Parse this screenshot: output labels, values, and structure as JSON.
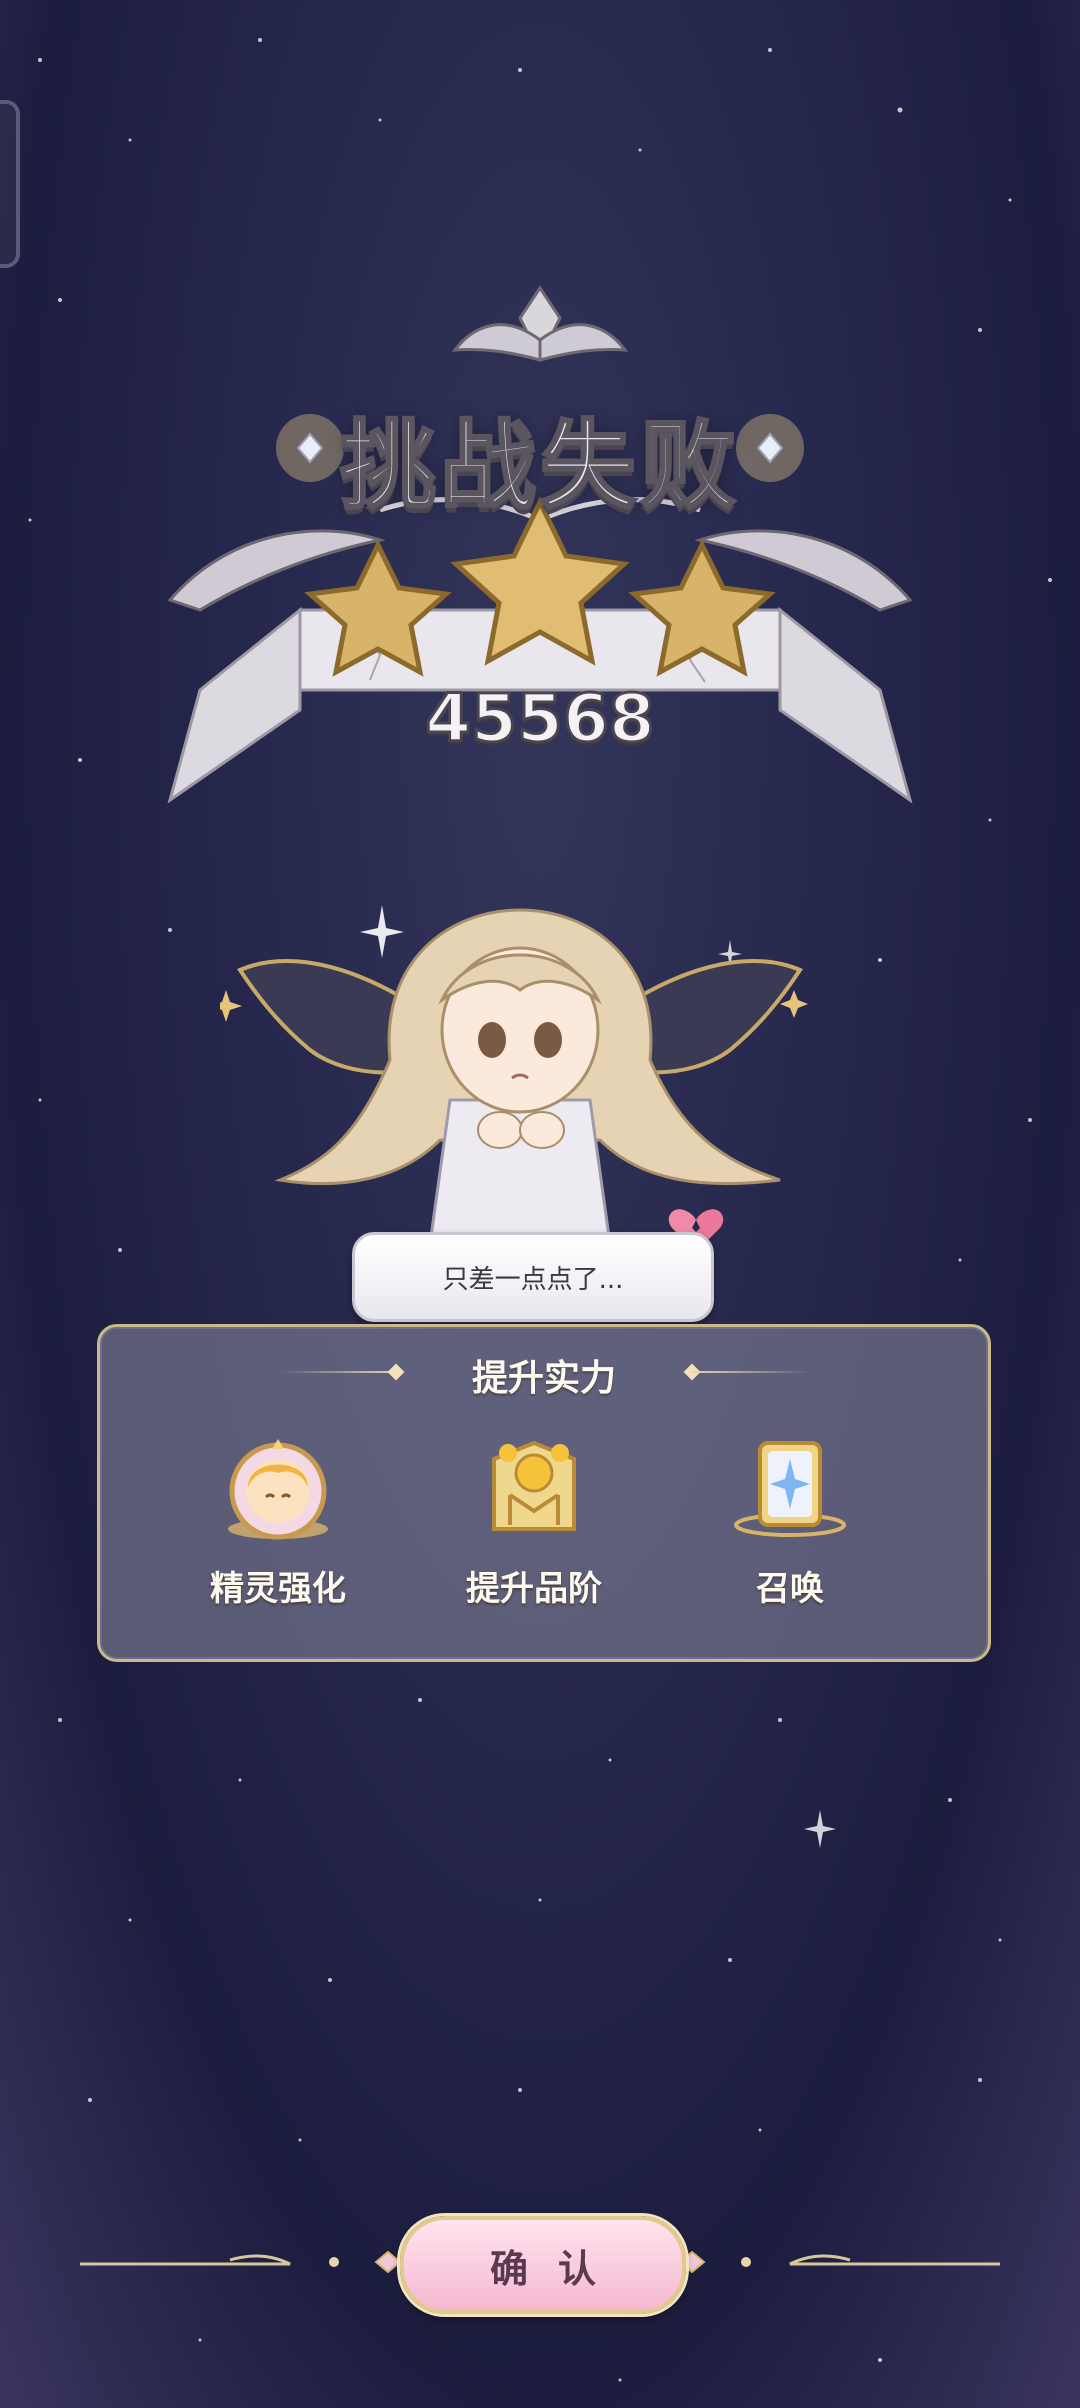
{
  "result": {
    "title": "挑战失败",
    "score": "45568",
    "stars_earned": 3,
    "stars_total": 3
  },
  "character": {
    "speech": "只差一点点了..."
  },
  "improve_panel": {
    "title": "提升实力",
    "actions": [
      {
        "label": "精灵强化",
        "icon": "fairy-portrait-icon"
      },
      {
        "label": "提升品阶",
        "icon": "rank-up-icon"
      },
      {
        "label": "召唤",
        "icon": "summon-card-icon"
      }
    ]
  },
  "confirm": {
    "label": "确认"
  },
  "colors": {
    "background": "#24254a",
    "gold": "#d8b46a",
    "panel_border": "#cbb98a",
    "button_pink": "#f5b8d0"
  }
}
